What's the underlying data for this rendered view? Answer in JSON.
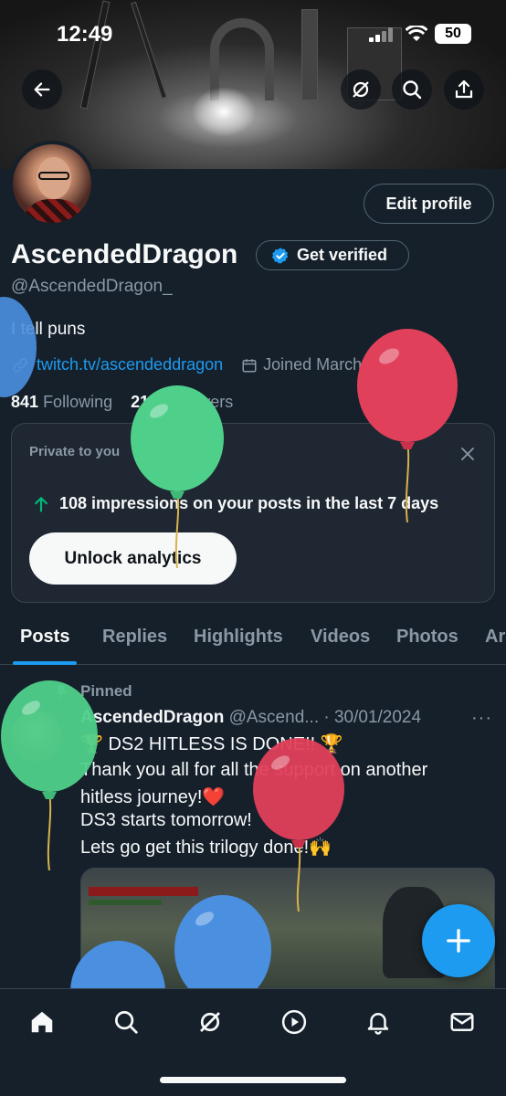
{
  "status_bar": {
    "time": "12:49",
    "battery": "50"
  },
  "header": {
    "back_icon": "arrow-left-icon",
    "grok_icon": "grok-icon",
    "search_icon": "search-icon",
    "share_icon": "share-icon"
  },
  "profile": {
    "display_name": "AscendedDragon",
    "get_verified_label": "Get verified",
    "handle": "@AscendedDragon_",
    "bio": "I tell puns",
    "link": "twitch.tv/ascendeddragon",
    "joined": "Joined March 2021",
    "following_count": "841",
    "following_label": "Following",
    "followers_count": "217",
    "followers_label": "Followers",
    "edit_profile_label": "Edit profile"
  },
  "analytics_card": {
    "label": "Private to you",
    "impressions_text": "108 impressions on your posts in the last 7 days",
    "unlock_label": "Unlock analytics"
  },
  "tabs": [
    {
      "label": "Posts",
      "active": true
    },
    {
      "label": "Replies"
    },
    {
      "label": "Highlights"
    },
    {
      "label": "Videos"
    },
    {
      "label": "Photos"
    },
    {
      "label": "Ar"
    }
  ],
  "pinned_post": {
    "pinned_label": "Pinned",
    "author": "AscendedDragon",
    "handle_date": "@Ascend... · 30/01/2024",
    "more": "···",
    "lines": [
      "🏆 DS2 HITLESS IS DONE!! 🏆",
      "Thank you all for all the support on another",
      "hitless journey!❤️",
      "DS3 starts tomorrow!",
      "Lets go get this trilogy done!🙌"
    ]
  },
  "bottom_nav": [
    "home-icon",
    "search-icon",
    "grok-icon",
    "play-icon",
    "bell-icon",
    "mail-icon"
  ],
  "colors": {
    "background": "#15202b",
    "accent": "#1d9bf0",
    "muted": "#8b98a5",
    "balloon_red": "#e0405a",
    "balloon_green": "#4fd08a",
    "balloon_blue": "#4a8fe0"
  }
}
